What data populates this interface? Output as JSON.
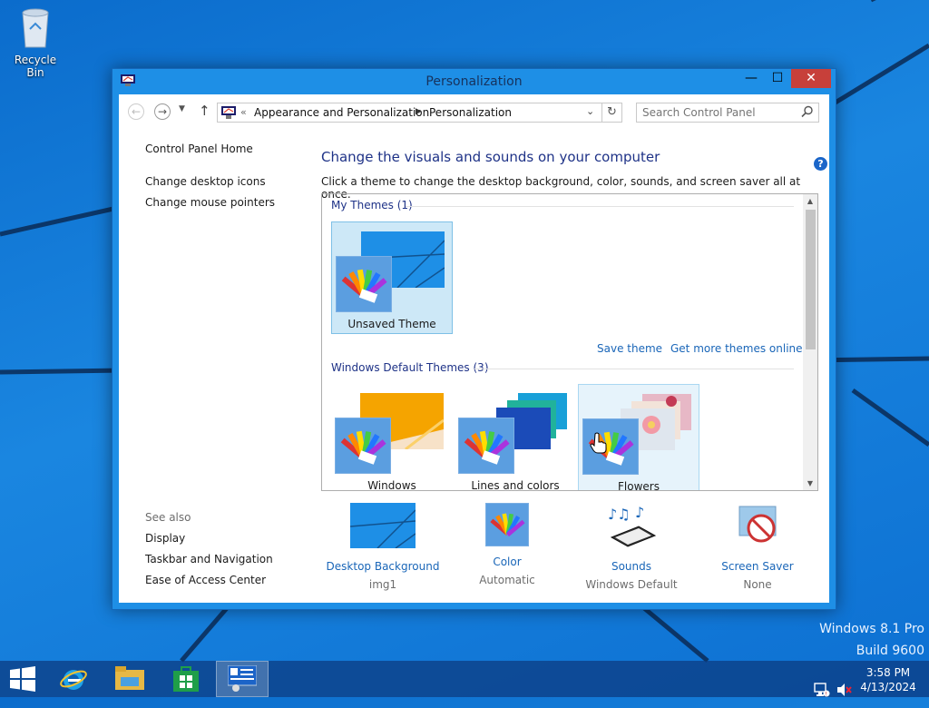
{
  "desktop": {
    "recycle_bin_label": "Recycle Bin",
    "watermark_line1": "Windows 8.1 Pro",
    "watermark_line2": "Build 9600"
  },
  "window": {
    "title": "Personalization",
    "close_glyph": "✕",
    "minimize_glyph": "—",
    "maximize_glyph": "☐"
  },
  "address": {
    "overflow": "«",
    "crumbs": [
      "Appearance and Personalization",
      "Personalization"
    ],
    "search_placeholder": "Search Control Panel"
  },
  "left_pane": {
    "home": "Control Panel Home",
    "links": [
      "Change desktop icons",
      "Change mouse pointers"
    ],
    "see_also_heading": "See also",
    "see_also": [
      "Display",
      "Taskbar and Navigation",
      "Ease of Access Center"
    ]
  },
  "main": {
    "heading": "Change the visuals and sounds on your computer",
    "description": "Click a theme to change the desktop background, color, sounds, and screen saver all at once.",
    "my_themes_label": "My Themes (1)",
    "my_themes": [
      {
        "name": "Unsaved Theme",
        "selected": true
      }
    ],
    "save_theme": "Save theme",
    "get_more": "Get more themes online",
    "default_themes_label": "Windows Default Themes (3)",
    "default_themes": [
      {
        "name": "Windows"
      },
      {
        "name": "Lines and colors"
      },
      {
        "name": "Flowers",
        "hovered": true
      }
    ]
  },
  "settings": [
    {
      "label": "Desktop Background",
      "value": "img1",
      "icon": "desktop-background-icon"
    },
    {
      "label": "Color",
      "value": "Automatic",
      "icon": "color-palette-icon"
    },
    {
      "label": "Sounds",
      "value": "Windows Default",
      "icon": "sounds-icon"
    },
    {
      "label": "Screen Saver",
      "value": "None",
      "icon": "screen-saver-icon"
    }
  ],
  "taskbar": {
    "clock_time": "3:58 PM",
    "clock_date": "4/13/2024"
  },
  "colors": {
    "link": "#1a66b8",
    "heading": "#1e3287",
    "close_button": "#c7403a",
    "selection": "#cde8f7"
  }
}
